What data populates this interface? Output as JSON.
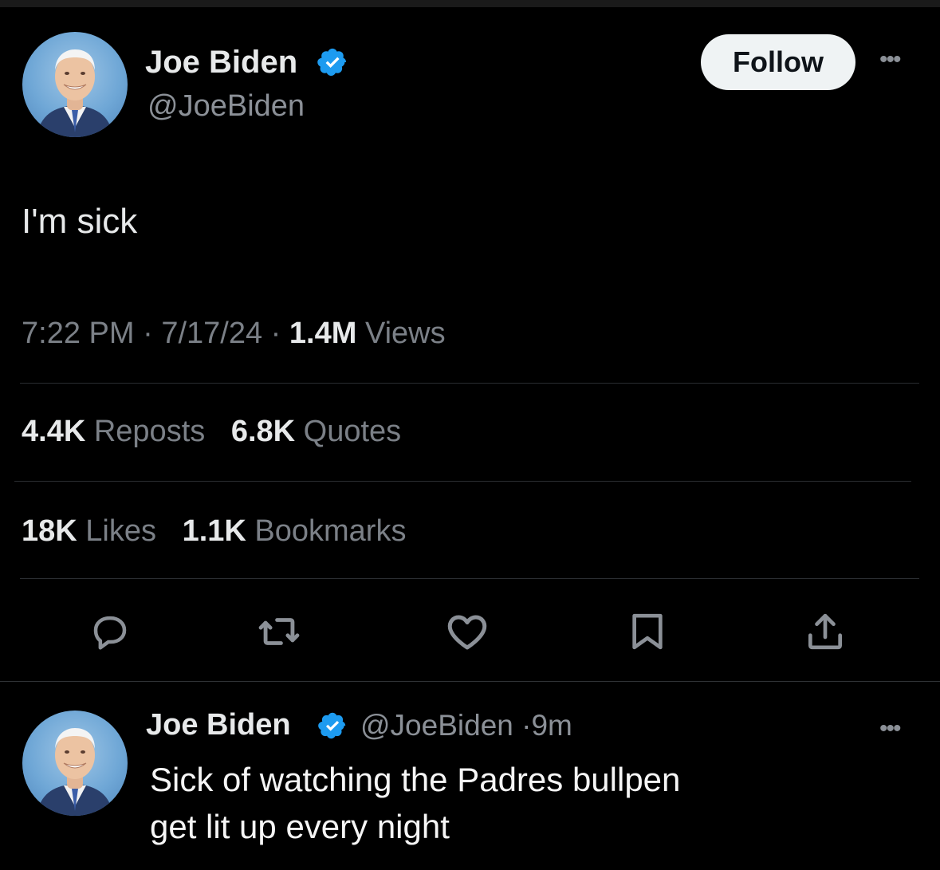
{
  "main_tweet": {
    "author_name": "Joe Biden",
    "author_handle": "@JoeBiden",
    "follow_label": "Follow",
    "text": "I'm sick",
    "time": "7:22 PM",
    "date": "7/17/24",
    "views_count": "1.4M",
    "views_label": "Views",
    "reposts_count": "4.4K",
    "reposts_label": "Reposts",
    "quotes_count": "6.8K",
    "quotes_label": "Quotes",
    "likes_count": "18K",
    "likes_label": "Likes",
    "bookmarks_count": "1.1K",
    "bookmarks_label": "Bookmarks",
    "separator": "·"
  },
  "reply": {
    "author_name": "Joe Biden",
    "author_handle": "@JoeBiden",
    "time_ago": "9m",
    "separator": "·",
    "text_line1": "Sick of watching the Padres bullpen",
    "text_line2": "get lit up every night"
  },
  "icons": {
    "verified": "verified-badge-icon",
    "more": "more-options-icon",
    "reply": "reply-icon",
    "repost": "repost-icon",
    "like": "heart-icon",
    "bookmark": "bookmark-icon",
    "share": "share-icon"
  },
  "colors": {
    "background": "#000000",
    "primary_text": "#e7e9ea",
    "secondary_text": "#7b8087",
    "verified_badge": "#1d9bf0",
    "follow_button_bg": "#eff3f4"
  }
}
